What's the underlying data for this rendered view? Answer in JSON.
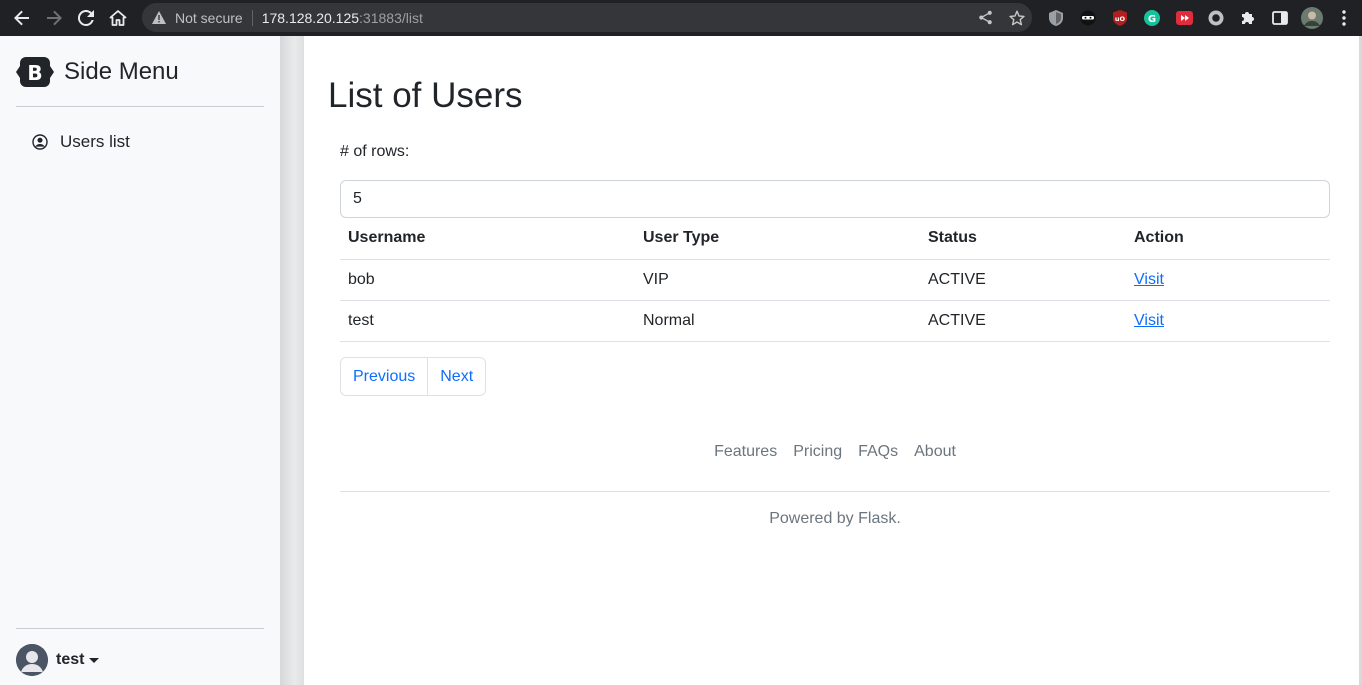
{
  "browser": {
    "security_label": "Not secure",
    "url_host": "178.128.20.125",
    "url_port_path": ":31883/list"
  },
  "sidebar": {
    "brand_letter": "B",
    "brand_title": "Side Menu",
    "items": [
      {
        "label": "Users list",
        "icon": "person-circle-icon"
      }
    ],
    "user": {
      "name": "test"
    }
  },
  "main": {
    "title": "List of Users",
    "rows_label": "# of rows:",
    "rows_value": "5",
    "table": {
      "headers": [
        "Username",
        "User Type",
        "Status",
        "Action"
      ],
      "rows": [
        {
          "username": "bob",
          "user_type": "VIP",
          "status": "ACTIVE",
          "action": "Visit"
        },
        {
          "username": "test",
          "user_type": "Normal",
          "status": "ACTIVE",
          "action": "Visit"
        }
      ]
    },
    "pagination": {
      "previous": "Previous",
      "next": "Next"
    },
    "footer": {
      "links": [
        "Features",
        "Pricing",
        "FAQs",
        "About"
      ],
      "powered_by": "Powered by Flask."
    }
  },
  "colors": {
    "link": "#0d6efd",
    "sidebar_bg": "#f8f9fa",
    "chrome_bg": "#202124"
  }
}
